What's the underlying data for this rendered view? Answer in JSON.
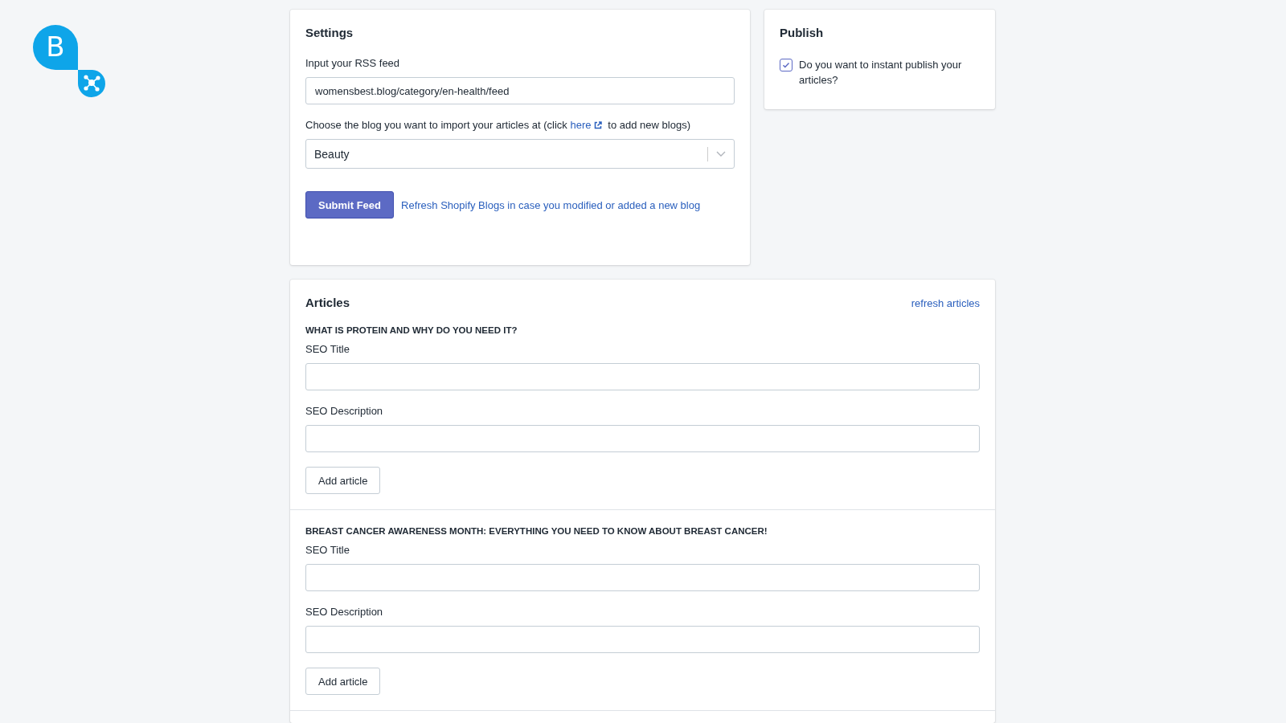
{
  "logo": {
    "letter": "B"
  },
  "settings": {
    "title": "Settings",
    "rss_label": "Input your RSS feed",
    "rss_value": "womensbest.blog/category/en-health/feed",
    "blog_label_before": "Choose the blog you want to import your articles at (click",
    "blog_link": "here",
    "blog_label_after": "to add new blogs)",
    "blog_select": "Beauty",
    "submit_button": "Submit Feed",
    "refresh_link": "Refresh Shopify Blogs in case you modified or added a new blog"
  },
  "publish": {
    "title": "Publish",
    "instant_publish": {
      "label": "Do you want to instant publish your articles?",
      "checked": true
    }
  },
  "articles": {
    "title": "Articles",
    "refresh_link": "refresh articles",
    "items": [
      {
        "title": "WHAT IS PROTEIN AND WHY DO YOU NEED IT?",
        "seo_title_label": "SEO Title",
        "seo_description_label": "SEO Description",
        "button": "Add article"
      },
      {
        "title": "BREAST CANCER AWARENESS MONTH: EVERYTHING YOU NEED TO KNOW ABOUT BREAST CANCER!",
        "seo_title_label": "SEO Title",
        "seo_description_label": "SEO Description",
        "button": "Add article"
      }
    ]
  }
}
